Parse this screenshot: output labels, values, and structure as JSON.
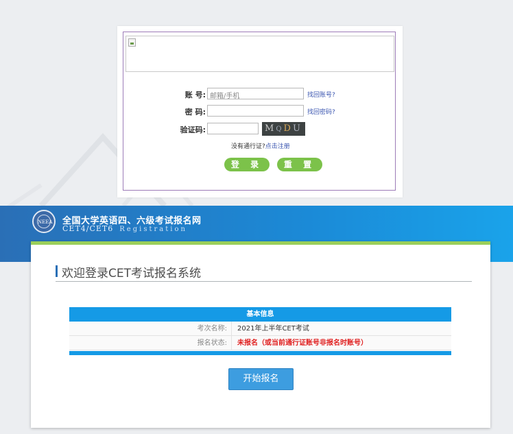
{
  "login": {
    "account_label": "账  号:",
    "account_placeholder": "邮箱/手机",
    "account_link": "找回账号?",
    "password_label": "密  码:",
    "password_link": "找回密码?",
    "captcha_label": "验证码:",
    "captcha_chars": [
      "M",
      "Q",
      "D",
      "U"
    ],
    "register_prefix": "没有通行证?",
    "register_link": "点击注册",
    "login_button": "登 录",
    "reset_button": "重 置"
  },
  "header": {
    "logo_text": "NEEA",
    "title": "全国大学英语四、六级考试报名网",
    "subtitle_cet": "CET4/CET6",
    "subtitle_reg": "Registration"
  },
  "main": {
    "welcome": "欢迎登录CET考试报名系统",
    "table_title": "基本信息",
    "rows": [
      {
        "key": "考次名称:",
        "value": "2021年上半年CET考试"
      },
      {
        "key": "报名状态:",
        "value": "未报名（或当前通行证账号非报名时账号）"
      }
    ],
    "start_button": "开始报名"
  },
  "colors": {
    "accent_blue": "#159ae6",
    "green": "#7cc24a",
    "status_red": "#e02020"
  }
}
